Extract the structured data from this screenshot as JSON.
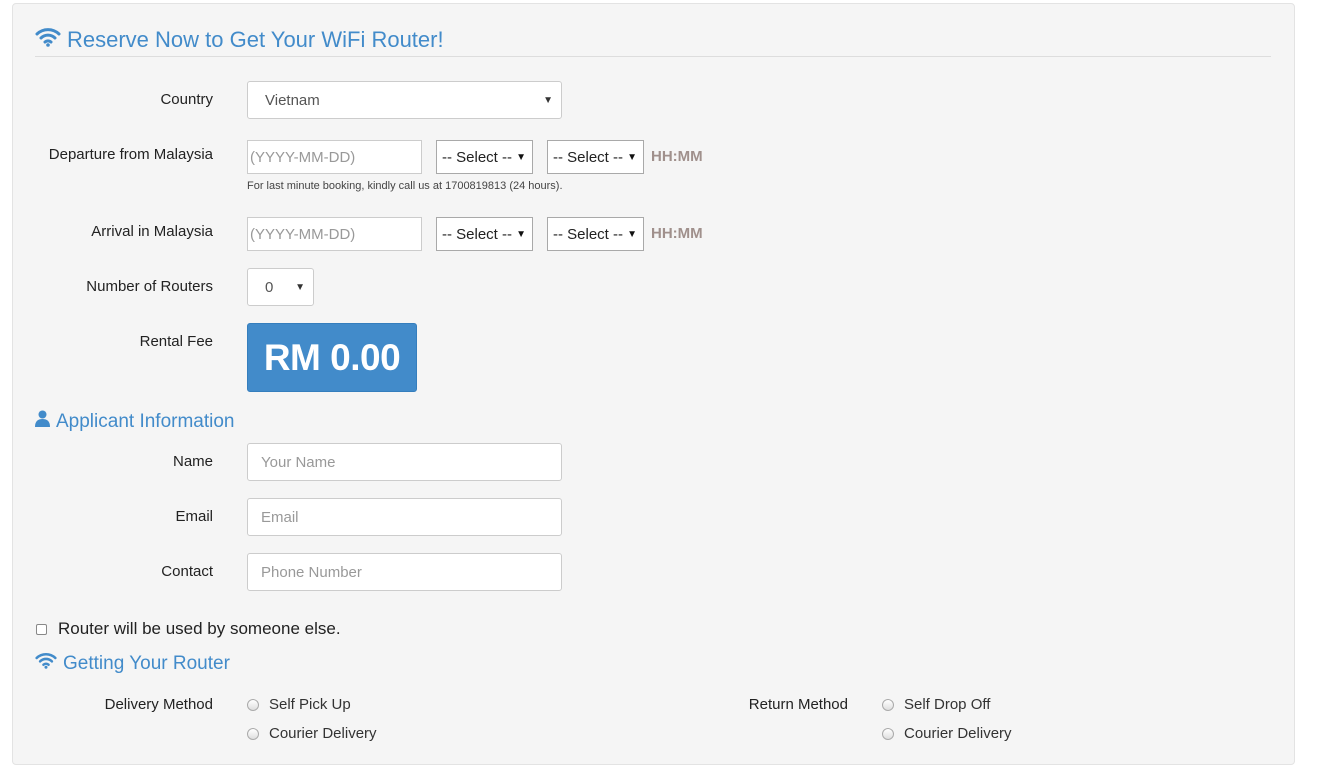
{
  "reserve": {
    "title": "Reserve Now to Get Your WiFi Router!",
    "icon": "wifi-icon"
  },
  "country": {
    "label": "Country",
    "value": "Vietnam"
  },
  "departure": {
    "label": "Departure from Malaysia",
    "date_placeholder": "(YYYY-MM-DD)",
    "hour_value": "-- Select --",
    "minute_value": "-- Select --",
    "time_format": "HH:MM",
    "help_text": "For last minute booking, kindly call us at 1700819813 (24 hours)."
  },
  "arrival": {
    "label": "Arrival in Malaysia",
    "date_placeholder": "(YYYY-MM-DD)",
    "hour_value": "-- Select --",
    "minute_value": "-- Select --",
    "time_format": "HH:MM"
  },
  "routers": {
    "label": "Number of Routers",
    "value": "0"
  },
  "rental_fee": {
    "label": "Rental Fee",
    "value": "RM 0.00"
  },
  "applicant": {
    "title": "Applicant Information",
    "icon": "user-icon",
    "name": {
      "label": "Name",
      "placeholder": "Your Name"
    },
    "email": {
      "label": "Email",
      "placeholder": "Email"
    },
    "contact": {
      "label": "Contact",
      "placeholder": "Phone Number"
    }
  },
  "someone_else": {
    "label": "Router will be used by someone else.",
    "checked": false
  },
  "getting": {
    "title": "Getting Your Router",
    "icon": "wifi-icon",
    "delivery": {
      "label": "Delivery Method",
      "options": [
        "Self Pick Up",
        "Courier Delivery"
      ]
    },
    "return": {
      "label": "Return Method",
      "options": [
        "Self Drop Off",
        "Courier Delivery"
      ]
    }
  },
  "colors": {
    "accent": "#428bca",
    "panel": "#f5f5f5",
    "time_hint": "#a0908c"
  }
}
